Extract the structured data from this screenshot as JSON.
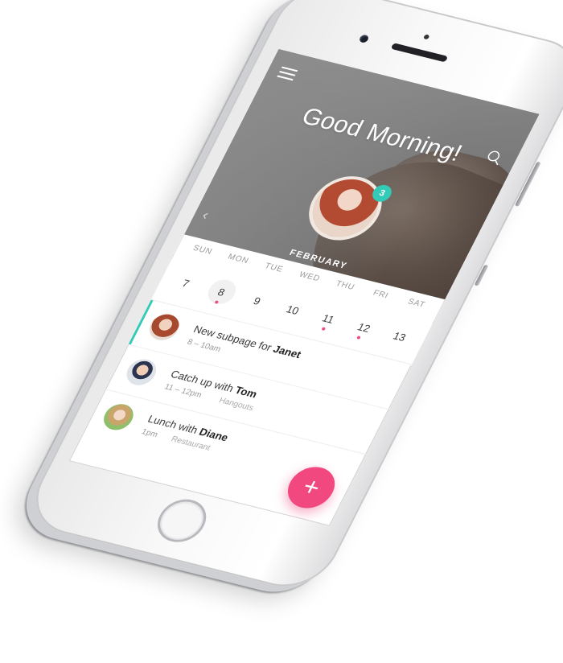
{
  "header": {
    "greeting": "Good Morning!",
    "badge_count": "3",
    "month": "FEBRUARY",
    "menu_icon": "hamburger-menu-icon",
    "search_icon": "search-icon"
  },
  "calendar": {
    "weekdays": [
      "SUN",
      "MON",
      "TUE",
      "WED",
      "THU",
      "FRI",
      "SAT"
    ],
    "days": [
      "7",
      "8",
      "9",
      "10",
      "11",
      "12",
      "13"
    ],
    "selected_day": "8",
    "days_with_events": [
      "8",
      "11",
      "12"
    ]
  },
  "events": [
    {
      "title": "New subpage for ",
      "person": "Janet",
      "time": "8 – 10am",
      "place": ""
    },
    {
      "title": "Catch up with ",
      "person": "Tom",
      "time": "11 – 12pm",
      "place": "Hangouts"
    },
    {
      "title": "Lunch with ",
      "person": "Diane",
      "time": "1pm",
      "place": "Restaurant"
    }
  ],
  "fab": {
    "label": "+"
  },
  "colors": {
    "accent_teal": "#33cbb8",
    "accent_pink": "#f0487f"
  }
}
